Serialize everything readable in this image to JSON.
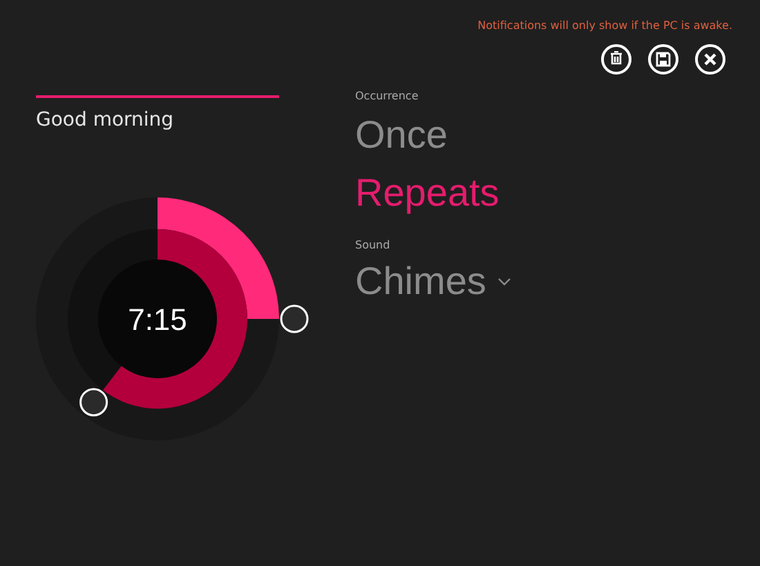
{
  "notice": "Notifications will only show if the PC is awake.",
  "actions": [
    {
      "kind": "delete"
    },
    {
      "kind": "save"
    },
    {
      "kind": "close"
    }
  ],
  "alarm_name": "Good morning",
  "dial": {
    "time": "7:15"
  },
  "occurrence": {
    "label": "Occurrence",
    "options": [
      {
        "label": "Once",
        "selected": false
      },
      {
        "label": "Repeats",
        "selected": true
      }
    ]
  },
  "sound": {
    "label": "Sound",
    "value": "Chimes"
  }
}
